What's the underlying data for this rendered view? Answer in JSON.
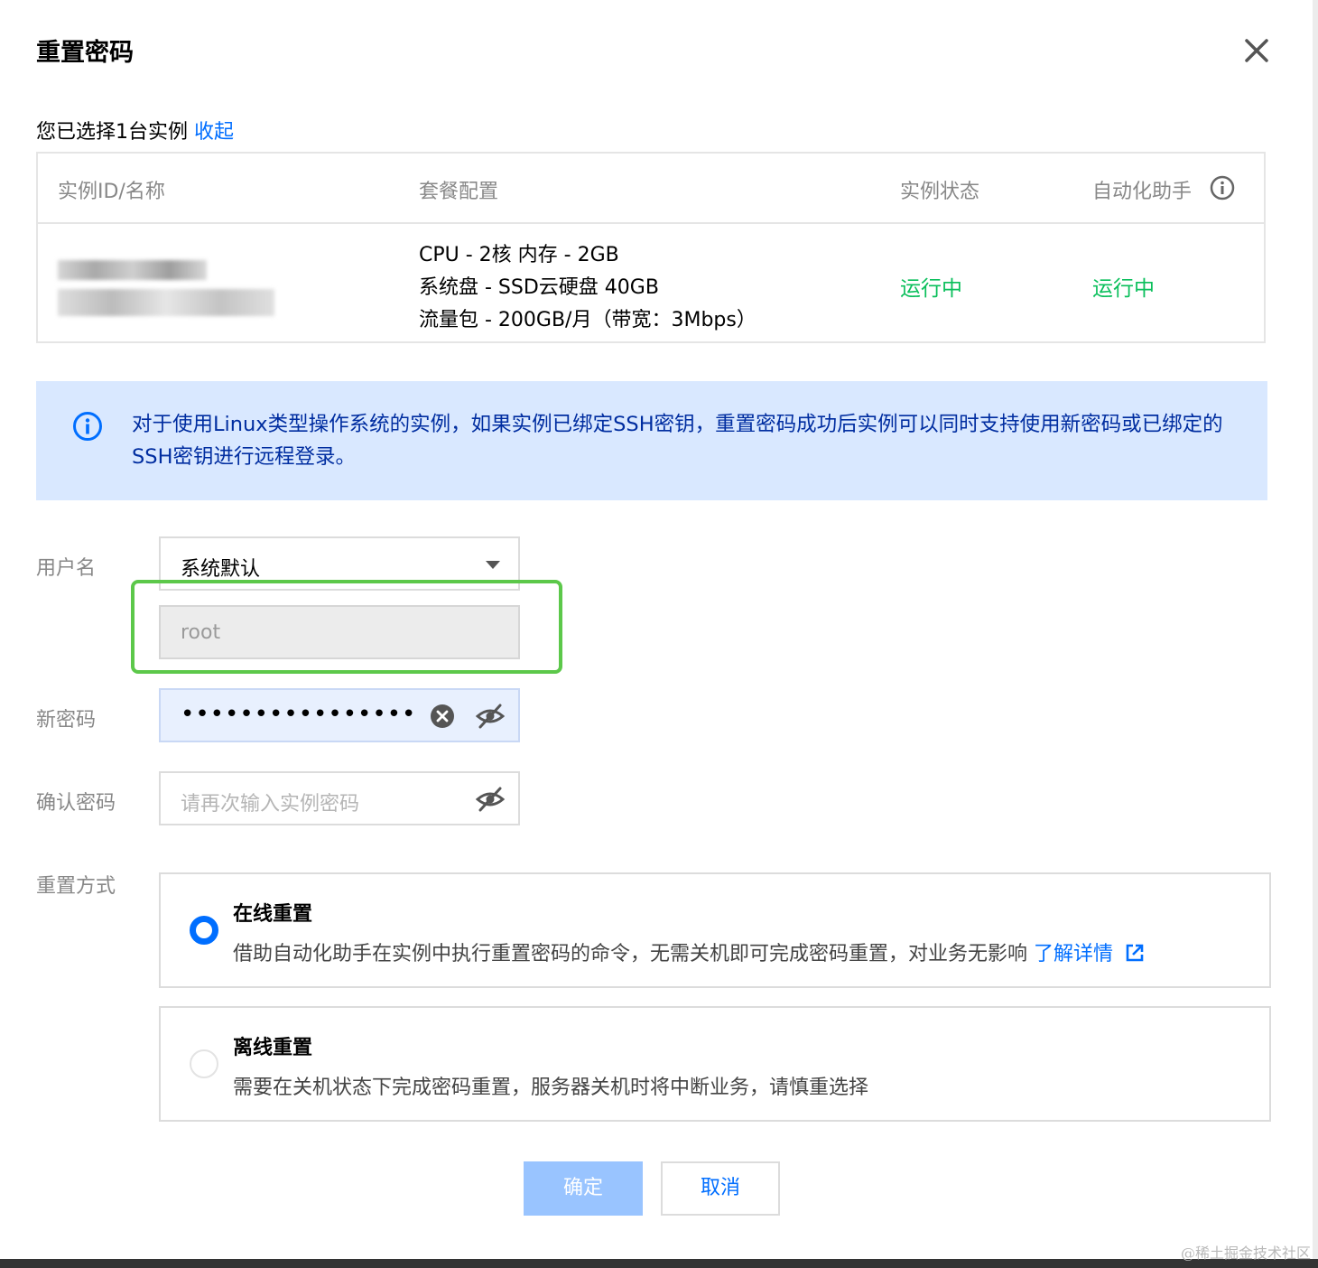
{
  "dialog": {
    "title": "重置密码",
    "selection_text": "您已选择1台实例",
    "collapse_link": "收起"
  },
  "table": {
    "headers": [
      "实例ID/名称",
      "套餐配置",
      "实例状态",
      "自动化助手"
    ],
    "row": {
      "config": [
        "CPU - 2核 内存 - 2GB",
        "系统盘 - SSD云硬盘 40GB",
        "流量包 - 200GB/月（带宽：3Mbps）"
      ],
      "instance_status": "运行中",
      "automation_status": "运行中"
    }
  },
  "notice": {
    "text": "对于使用Linux类型操作系统的实例，如果实例已绑定SSH密钥，重置密码成功后实例可以同时支持使用新密码或已绑定的SSH密钥进行远程登录。"
  },
  "form": {
    "username_label": "用户名",
    "username_select_value": "系统默认",
    "username_value": "root",
    "new_password_label": "新密码",
    "new_password_value": "••••••••••••••••",
    "confirm_password_label": "确认密码",
    "confirm_password_placeholder": "请再次输入实例密码",
    "reset_method_label": "重置方式"
  },
  "reset_options": [
    {
      "title": "在线重置",
      "description": "借助自动化助手在实例中执行重置密码的命令，无需关机即可完成密码重置，对业务无影响",
      "link": "了解详情",
      "selected": true
    },
    {
      "title": "离线重置",
      "description": "需要在关机状态下完成密码重置，服务器关机时将中断业务，请慎重选择",
      "selected": false
    }
  ],
  "buttons": {
    "ok": "确定",
    "cancel": "取消"
  },
  "watermark": "@稀土掘金技术社区",
  "colors": {
    "accent": "#006eff",
    "status_running": "#0abf5b",
    "notice_bg": "#d9e8ff",
    "highlight_box": "#5cc84a"
  }
}
